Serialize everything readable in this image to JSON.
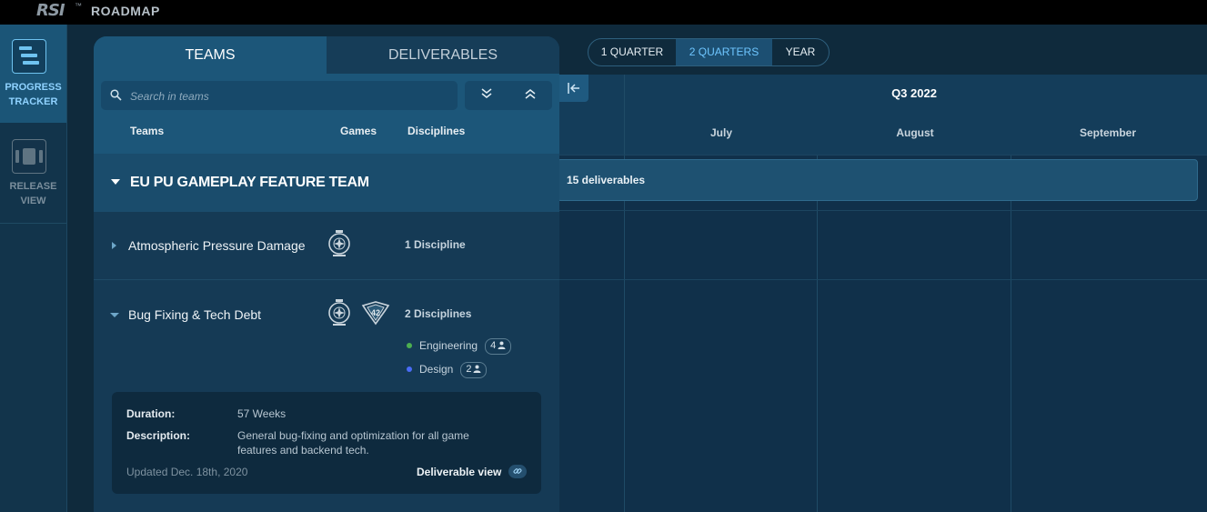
{
  "topbar": {
    "logo": "RSI",
    "tm": "™",
    "title": "ROADMAP"
  },
  "rail": [
    {
      "label_line1": "PROGRESS",
      "label_line2": "TRACKER",
      "active": true
    },
    {
      "label_line1": "RELEASE",
      "label_line2": "VIEW",
      "active": false
    }
  ],
  "panel": {
    "tabs": [
      "TEAMS",
      "DELIVERABLES"
    ],
    "search_placeholder": "Search in teams",
    "columns": [
      "Teams",
      "Games",
      "Disciplines"
    ],
    "group": {
      "title": "EU PU GAMEPLAY FEATURE TEAM"
    },
    "teams": [
      {
        "name": "Atmospheric Pressure Damage",
        "disciplines": "1 Discipline"
      },
      {
        "name": "Bug Fixing & Tech Debt",
        "disciplines": "2 Disciplines",
        "items": [
          {
            "name": "Engineering",
            "members": "4",
            "color": "#4caf50"
          },
          {
            "name": "Design",
            "members": "2",
            "color": "#4a6cf7"
          }
        ],
        "details": {
          "duration_label": "Duration:",
          "duration": "57 Weeks",
          "description_label": "Description:",
          "description": "General bug-fixing and optimization for all game features and backend tech.",
          "updated": "Updated Dec. 18th, 2020",
          "link": "Deliverable view"
        }
      }
    ]
  },
  "zoom": {
    "options": [
      "1 QUARTER",
      "2 QUARTERS",
      "YEAR"
    ],
    "selected": "2 QUARTERS"
  },
  "timeline": {
    "quarter": "Q3 2022",
    "months": [
      "July",
      "August",
      "September"
    ],
    "deliverables": "15 deliverables"
  },
  "colors": {
    "accent": "#6ec6ff",
    "panel": "#16405d",
    "background": "#0f2a3c"
  }
}
